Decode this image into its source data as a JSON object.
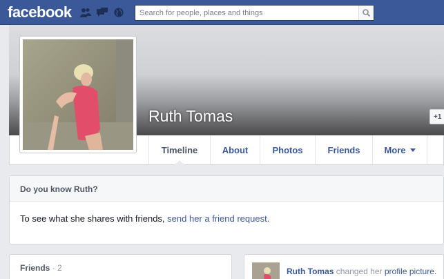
{
  "app": {
    "logo_text": "facebook"
  },
  "search": {
    "placeholder": "Search for people, places and things"
  },
  "profile": {
    "name": "Ruth Tomas",
    "add_friend_label": "+1"
  },
  "nav": {
    "tabs": [
      {
        "label": "Timeline"
      },
      {
        "label": "About"
      },
      {
        "label": "Photos"
      },
      {
        "label": "Friends"
      },
      {
        "label": "More"
      }
    ]
  },
  "know_card": {
    "title": "Do you know Ruth?",
    "body_text": "To see what she shares with friends, ",
    "link_text": "send her a friend request."
  },
  "friends_card": {
    "title": "Friends",
    "count": "· 2"
  },
  "story": {
    "actor": "Ruth Tomas",
    "action_text": " changed her ",
    "object_link": "profile picture."
  },
  "colors": {
    "brand_blue": "#3b5998",
    "link": "#3b5998",
    "background": "#e9eaed"
  }
}
